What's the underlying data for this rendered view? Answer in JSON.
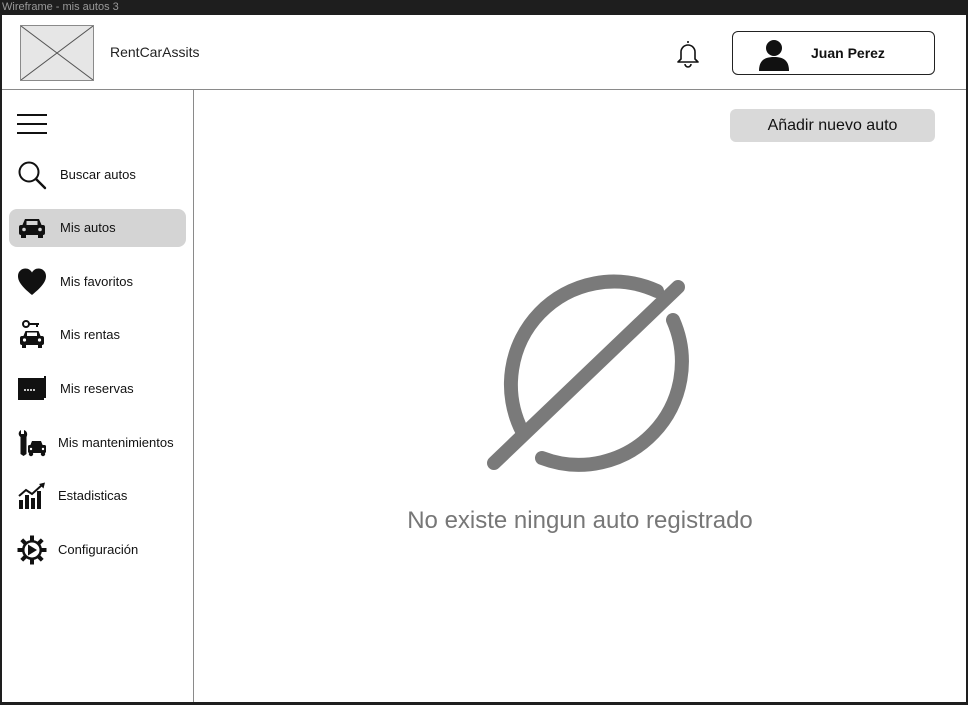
{
  "window": {
    "title": "Wireframe - mis autos 3"
  },
  "header": {
    "app_name": "RentCarAssits",
    "user_name": "Juan Perez"
  },
  "sidebar": {
    "items": [
      {
        "label": "Buscar autos",
        "icon": "search-icon",
        "active": false
      },
      {
        "label": "Mis autos",
        "icon": "car-icon",
        "active": true
      },
      {
        "label": "Mis favoritos",
        "icon": "heart-icon",
        "active": false
      },
      {
        "label": "Mis rentas",
        "icon": "car-key-icon",
        "active": false
      },
      {
        "label": "Mis reservas",
        "icon": "reservation-card-icon",
        "active": false
      },
      {
        "label": "Mis mantenimientos",
        "icon": "wrench-car-icon",
        "active": false
      },
      {
        "label": "Estadisticas",
        "icon": "stats-chart-icon",
        "active": false
      },
      {
        "label": "Configuración",
        "icon": "gear-icon",
        "active": false
      }
    ]
  },
  "main": {
    "add_button_label": "Añadir nuevo auto",
    "empty_message": "No existe ningun auto registrado",
    "empty_icon": "empty-set-icon"
  },
  "colors": {
    "active_nav_bg": "#d4d4d4",
    "button_bg": "#d9d9d9",
    "empty_icon": "#7a7a7a",
    "empty_text": "#777777"
  }
}
